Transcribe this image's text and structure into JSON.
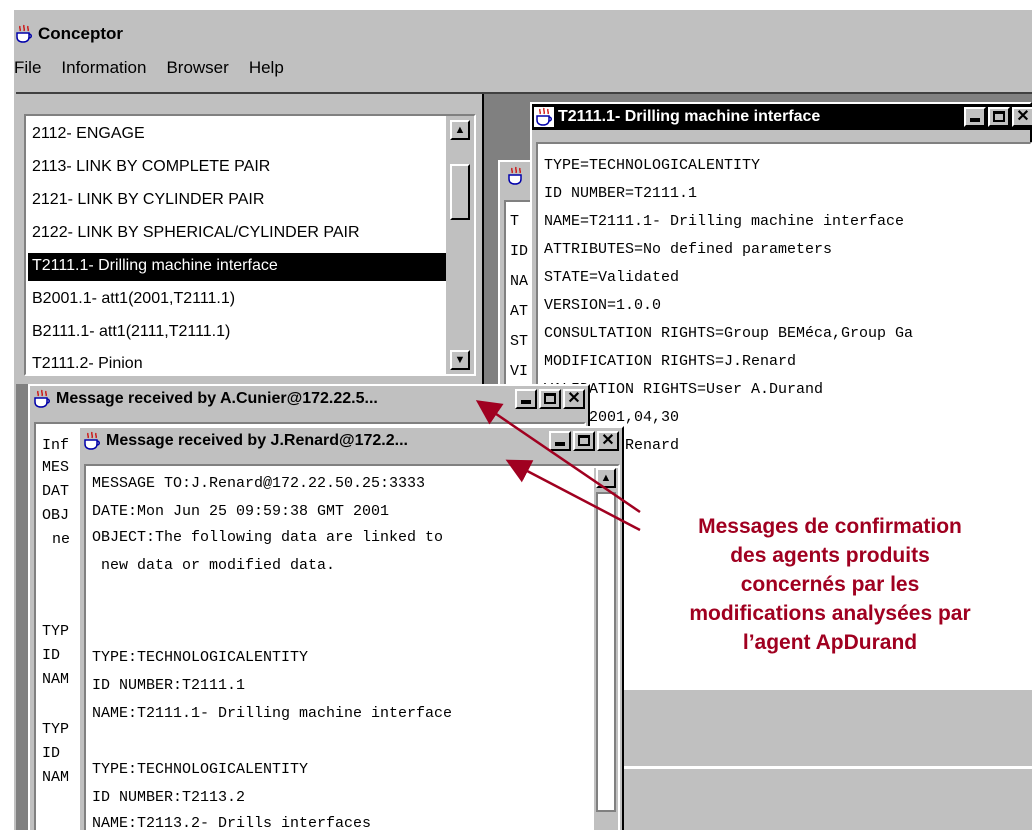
{
  "app": {
    "title": "Conceptor",
    "menu": [
      "File",
      "Information",
      "Browser",
      "Help"
    ]
  },
  "tree_list": {
    "items": [
      "2112- ENGAGE",
      "2113- LINK BY COMPLETE PAIR",
      "2121- LINK BY CYLINDER PAIR",
      "2122- LINK BY SPHERICAL/CYLINDER PAIR",
      "T2111.1- Drilling machine interface",
      "B2001.1- att1(2001,T2111.1)",
      "B2111.1- att1(2111,T2111.1)",
      "T2111.2- Pinion"
    ],
    "selected": "T2111.1- Drilling machine interface"
  },
  "entity_window": {
    "title": "T2111.1- Drilling machine interface",
    "lines": [
      "TYPE=TECHNOLOGICALENTITY",
      "ID NUMBER=T2111.1",
      "NAME=T2111.1- Drilling machine interface",
      "ATTRIBUTES=No defined parameters",
      "STATE=Validated",
      "VERSION=1.0.0",
      "CONSULTATION RIGHTS=Group BEMéca,Group Ga",
      "MODIFICATION RIGHTS=J.Renard",
      "VALIDATION RIGHTS=User A.Durand",
      "DATE=2001,04,30",
      "AUTHOR=J.Renard"
    ]
  },
  "background_window": {
    "lines": [
      "T",
      "ID",
      "NA",
      "AT",
      "ST",
      "VI"
    ]
  },
  "msg_cunier": {
    "title": "Message received by A.Cunier@172.22.5...",
    "lines": [
      "Inf",
      "MES",
      "DAT",
      "OBJ",
      "ne",
      "",
      "",
      "TYP",
      "ID",
      "NAM",
      "",
      "TYP",
      "ID",
      "NAM"
    ]
  },
  "msg_renard": {
    "title": "Message received by J.Renard@172.2...",
    "lines": [
      "MESSAGE TO:J.Renard@172.22.50.25:3333",
      "DATE:Mon Jun 25 09:59:38 GMT 2001",
      "OBJECT:The following data are linked to",
      " new data or modified data.",
      "",
      "",
      "TYPE:TECHNOLOGICALENTITY",
      "ID NUMBER:T2111.1",
      "NAME:T2111.1- Drilling machine interface",
      "",
      "TYPE:TECHNOLOGICALENTITY",
      "ID NUMBER:T2113.2",
      "NAME:T2113.2- Drills interfaces"
    ]
  },
  "annotation": {
    "lines": [
      "Messages de confirmation",
      "des agents produits",
      "concernés par les",
      "modifications analysées par",
      "l’agent ApDurand"
    ],
    "color": "#a00020"
  }
}
